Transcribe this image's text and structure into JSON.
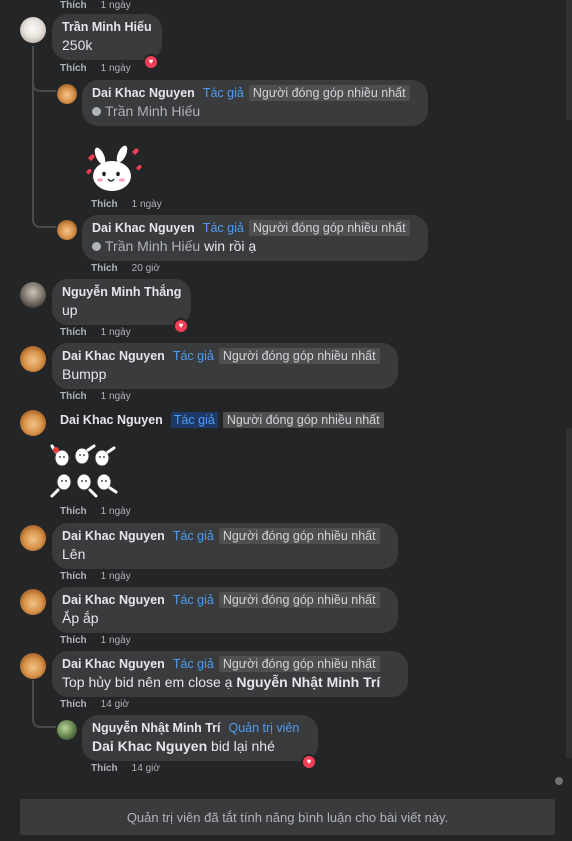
{
  "like_label": "Thích",
  "badges": {
    "author": "Tác giả",
    "top_contributor": "Người đóng góp nhiều nhất",
    "admin": "Quản trị viên"
  },
  "icons": {
    "reaction": "heart-icon",
    "tag": "tag-icon"
  },
  "colors": {
    "background": "#242526",
    "bubble": "#3a3b3c",
    "link": "#4e9cf5",
    "heart": "#f33e58"
  },
  "comments": [
    {
      "time": "1 ngày"
    },
    {
      "author": "Trần Minh Hiếu",
      "text": "250k",
      "time": "1 ngày",
      "reaction": "love"
    },
    {
      "author": "Dai Khac Nguyen",
      "tag": "Trần Minh Hiếu",
      "text": "",
      "time": "1 ngày",
      "sticker": "bunny-love-sticker"
    },
    {
      "author": "Dai Khac Nguyen",
      "tag": "Trần Minh Hiếu",
      "text": "win rồi ạ",
      "time": "20 giờ"
    },
    {
      "author": "Nguyễn Minh Thắng",
      "text": "up",
      "time": "1 ngày",
      "reaction": "love"
    },
    {
      "author": "Dai Khac Nguyen",
      "text": "Bumpp",
      "time": "1 ngày"
    },
    {
      "author": "Dai Khac Nguyen",
      "text": "",
      "time": "1 ngày",
      "sticker": "dancing-cats-sticker"
    },
    {
      "author": "Dai Khac Nguyen",
      "text": "Lên",
      "time": "1 ngày"
    },
    {
      "author": "Dai Khac Nguyen",
      "text": "Ắp ắp",
      "time": "1 ngày"
    },
    {
      "author": "Dai Khac Nguyen",
      "text": "Top hủy bid nên em close ạ",
      "mention": "Nguyễn Nhật Minh Trí",
      "time": "14 giờ"
    },
    {
      "author": "Nguyễn Nhật Minh Trí",
      "mention": "Dai Khac Nguyen",
      "text": "bid lại nhé",
      "time": "14 giờ",
      "reaction": "love"
    }
  ],
  "footer": "Quản trị viên đã tắt tính năng bình luận cho bài viết này."
}
